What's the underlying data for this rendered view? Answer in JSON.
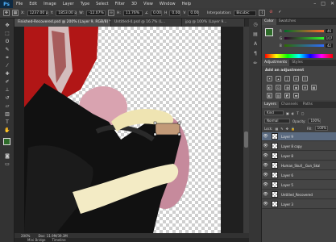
{
  "app": {
    "logo": "Ps"
  },
  "menu": [
    "File",
    "Edit",
    "Image",
    "Layer",
    "Type",
    "Select",
    "Filter",
    "3D",
    "View",
    "Window",
    "Help"
  ],
  "window_controls": {
    "minimize": "–",
    "maximize": "□",
    "close": "✕"
  },
  "options_bar": {
    "x_label": "X:",
    "x_value": "1237.00 p",
    "y_label": "Y:",
    "y_value": "1853.00 p",
    "w_label": "W:",
    "w_value": "-12.07%",
    "h_label": "H:",
    "h_value": "11.76%",
    "angle_value": "0.00",
    "h_skew_value": "0.00",
    "v_skew_value": "0.00",
    "interpolation_label": "Interpolation:",
    "interpolation_value": "Bicubic"
  },
  "tabs": [
    {
      "label": "Finished-Recovered.psd @ 200% (Layer 9, RGB/8) *",
      "active": true
    },
    {
      "label": "Untitled-4.psd @ 16.7% (L...",
      "active": false
    },
    {
      "label": "jpg @ 100% (Layer 9...",
      "active": false
    }
  ],
  "status": {
    "zoom": "200%",
    "doc": "Doc: 11.9M/39.3M"
  },
  "mini_bridge": {
    "tab1": "Mini Bridge",
    "tab2": "Timeline"
  },
  "panels": {
    "color_tabs": [
      "Color",
      "Swatches"
    ],
    "color_sliders": [
      {
        "label": "R",
        "value": "46"
      },
      {
        "label": "G",
        "value": "107"
      },
      {
        "label": "B",
        "value": "42"
      }
    ],
    "adjustment_tabs": [
      "Adjustments",
      "Styles"
    ],
    "adjustment_title": "Add an adjustment",
    "layers_tabs": [
      "Layers",
      "Channels",
      "Paths"
    ],
    "kind_label": "Kind",
    "blend_mode": "Normal",
    "opacity_label": "Opacity:",
    "opacity_value": "100%",
    "lock_label": "Lock:",
    "fill_label": "Fill:",
    "fill_value": "100%",
    "layers": [
      {
        "name": "Layer 9",
        "selected": true
      },
      {
        "name": "Layer 8 copy",
        "selected": false
      },
      {
        "name": "Layer 8",
        "selected": false
      },
      {
        "name": "Human_Skull__Gun_Skal",
        "selected": false
      },
      {
        "name": "Layer 6",
        "selected": false
      },
      {
        "name": "Layer 5",
        "selected": false
      },
      {
        "name": "Untitled_Recovered",
        "selected": false
      },
      {
        "name": "Layer 3",
        "selected": false
      }
    ]
  },
  "colors": {
    "foreground": "#2e6b2a",
    "background": "#efefef",
    "selection": "#5a6a80"
  }
}
